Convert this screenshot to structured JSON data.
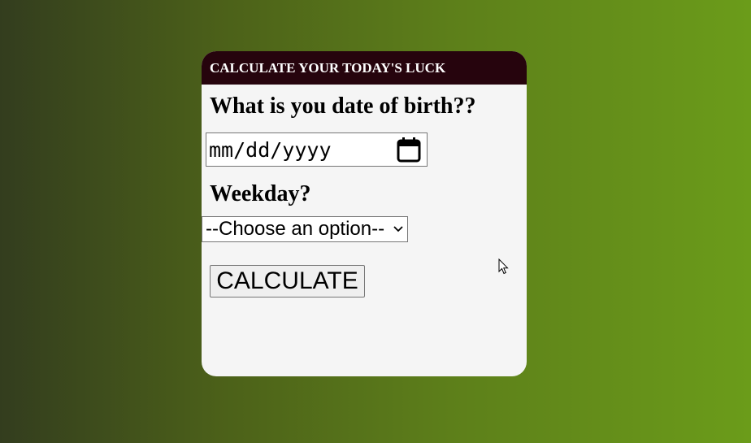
{
  "card": {
    "title": "CALCULATE YOUR TODAY'S LUCK"
  },
  "dob": {
    "question": "What is you date of birth??",
    "placeholder": "mm/dd/yyyy",
    "icon": "calendar-icon"
  },
  "weekday": {
    "question": "Weekday?",
    "selected_option": "--Choose an option--",
    "icon": "chevron-down-icon"
  },
  "actions": {
    "calculate_label": "CALCULATE"
  },
  "colors": {
    "header_bg": "#26040d",
    "card_bg": "#f5f5f5",
    "gradient_start": "#333d1e",
    "gradient_end": "#6b9c1a"
  }
}
